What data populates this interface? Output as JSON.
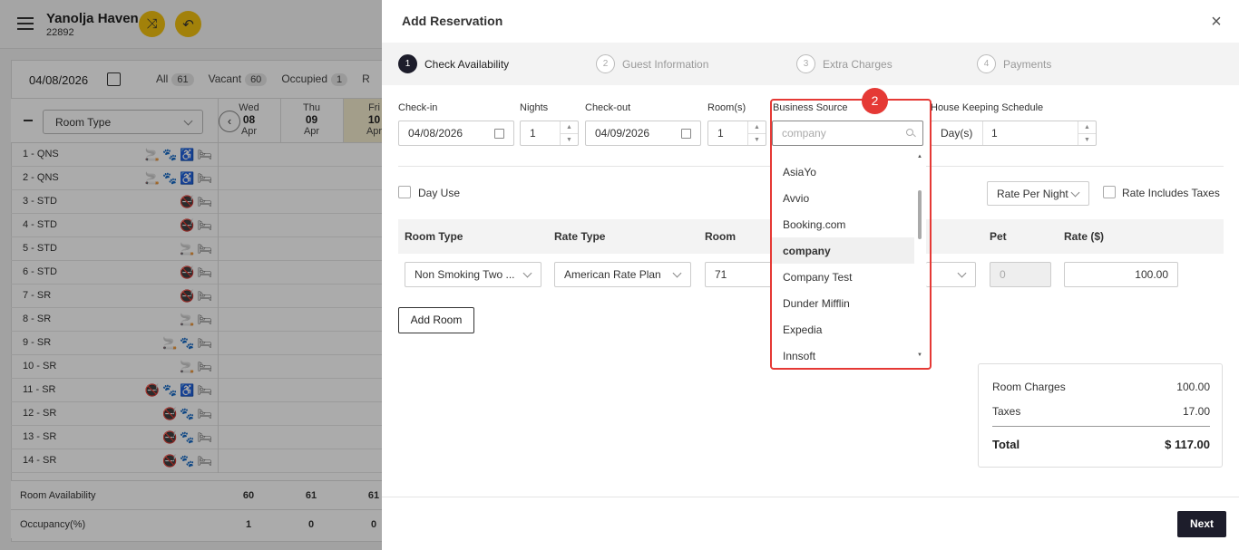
{
  "app": {
    "hotel_name": "Yanolja Haven",
    "hotel_id": "22892",
    "date": "04/08/2026",
    "filters": [
      {
        "label": "All",
        "count": "61"
      },
      {
        "label": "Vacant",
        "count": "60"
      },
      {
        "label": "Occupied",
        "count": "1"
      },
      {
        "label": "R",
        "count": ""
      }
    ],
    "room_type_select": "Room Type",
    "days": [
      {
        "dow": "Wed",
        "day": "08",
        "mon": "Apr"
      },
      {
        "dow": "Thu",
        "day": "09",
        "mon": "Apr"
      },
      {
        "dow": "Fri",
        "day": "10",
        "mon": "Apr"
      }
    ],
    "rooms": [
      {
        "name": "1 - QNS",
        "icons": "🚬🐾♿🛏"
      },
      {
        "name": "2 - QNS",
        "icons": "🚬🐾♿🛏"
      },
      {
        "name": "3 - STD",
        "icons": "🚭🛏"
      },
      {
        "name": "4 - STD",
        "icons": "🚭🛏"
      },
      {
        "name": "5 - STD",
        "icons": "🚬🛏"
      },
      {
        "name": "6 - STD",
        "icons": "🚭🛏"
      },
      {
        "name": "7 - SR",
        "icons": "🚭🛏"
      },
      {
        "name": "8 - SR",
        "icons": "🚬🛏"
      },
      {
        "name": "9 - SR",
        "icons": "🚬🐾🛏"
      },
      {
        "name": "10 - SR",
        "icons": "🚬🛏"
      },
      {
        "name": "11 - SR",
        "icons": "🚭🐾♿🛏"
      },
      {
        "name": "12 - SR",
        "icons": "🚭🐾🛏"
      },
      {
        "name": "13 - SR",
        "icons": "🚭🐾🛏"
      },
      {
        "name": "14 - SR",
        "icons": "🚭🐾🛏"
      }
    ],
    "room_availability": {
      "label": "Room Availability",
      "values": [
        "60",
        "61",
        "61"
      ]
    },
    "occupancy": {
      "label": "Occupancy(%)",
      "values": [
        "1",
        "0",
        "0"
      ]
    }
  },
  "modal": {
    "title": "Add Reservation",
    "steps": [
      {
        "num": "1",
        "label": "Check Availability"
      },
      {
        "num": "2",
        "label": "Guest Information"
      },
      {
        "num": "3",
        "label": "Extra Charges"
      },
      {
        "num": "4",
        "label": "Payments"
      }
    ],
    "fields": {
      "checkin_label": "Check-in",
      "checkin": "04/08/2026",
      "nights_label": "Nights",
      "nights": "1",
      "checkout_label": "Check-out",
      "checkout": "04/09/2026",
      "rooms_label": "Room(s)",
      "rooms": "1",
      "business_source_label": "Business Source",
      "business_source_placeholder": "company",
      "housekeeping_label": "House Keeping Schedule",
      "housekeeping_unit": "Day(s)",
      "housekeeping_value": "1"
    },
    "day_use": "Day Use",
    "rate_per_night": "Rate Per Night",
    "rate_includes_taxes": "Rate Includes Taxes",
    "table": {
      "headers": {
        "room_type": "Room Type",
        "rate_type": "Rate Type",
        "room": "Room",
        "pet": "Pet",
        "rate": "Rate ($)"
      },
      "row": {
        "room_type": "Non Smoking Two ...",
        "rate_type": "American Rate Plan",
        "room": "71",
        "pet": "0",
        "rate": "100.00"
      }
    },
    "add_room": "Add Room",
    "summary": {
      "room_charges_label": "Room Charges",
      "room_charges": "100.00",
      "taxes_label": "Taxes",
      "taxes": "17.00",
      "total_label": "Total",
      "total": "$ 117.00"
    },
    "next": "Next",
    "dropdown": {
      "items": [
        "AsiaYo",
        "Avvio",
        "Booking.com",
        "company",
        "Company Test",
        "Dunder Mifflin",
        "Expedia",
        "Innsoft"
      ],
      "selected": "company",
      "annotation": "2"
    }
  }
}
